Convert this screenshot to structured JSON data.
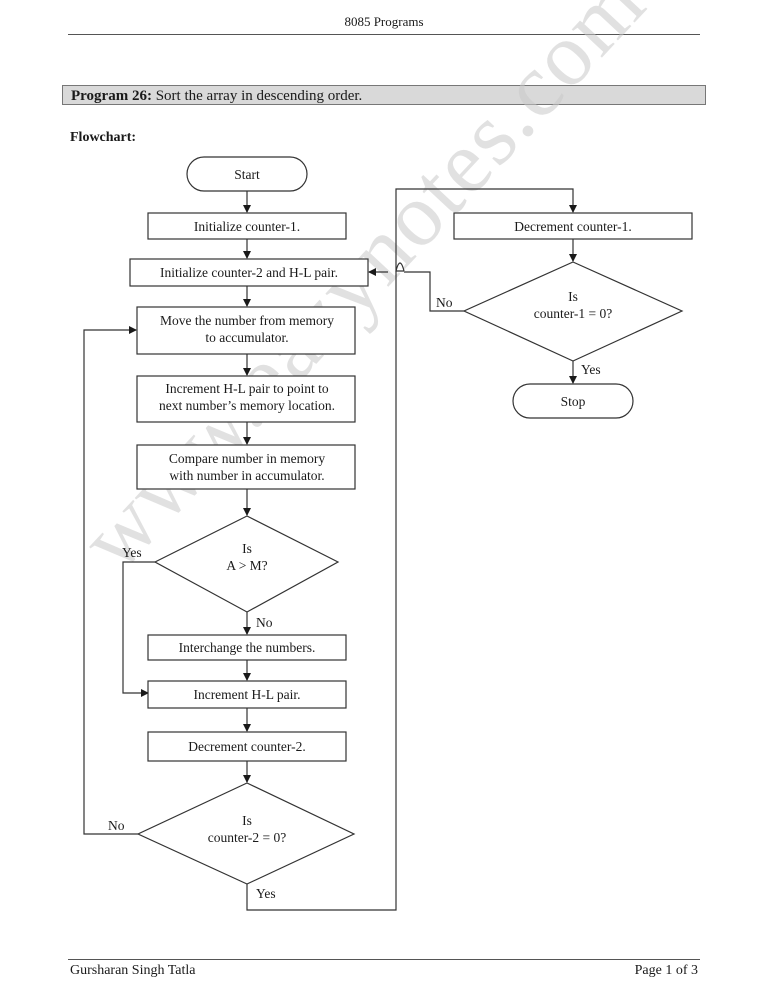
{
  "header": {
    "title": "8085 Programs"
  },
  "program": {
    "label": "Program 26:",
    "description": "Sort the array in descending order."
  },
  "section_label": "Flowchart:",
  "flowchart": {
    "nodes": {
      "start": "Start",
      "init_counter1": "Initialize counter-1.",
      "init_counter2": "Initialize counter-2 and H-L pair.",
      "move_line1": "Move the number from memory",
      "move_line2": "to accumulator.",
      "inc_hl_line1": "Increment H-L pair to point to",
      "inc_hl_line2": "next number’s memory location.",
      "compare_line1": "Compare number in memory",
      "compare_line2": "with number in accumulator.",
      "dec_a_m_line1": "Is",
      "dec_a_m_line2": "A > M?",
      "interchange": "Interchange the numbers.",
      "inc_hl_pair": "Increment H-L pair.",
      "dec_counter2": "Decrement counter-2.",
      "dec_c2_line1": "Is",
      "dec_c2_line2": "counter-2 = 0?",
      "dec_counter1": "Decrement counter-1.",
      "dec_c1_line1": "Is",
      "dec_c1_line2": "counter-1 = 0?",
      "stop": "Stop"
    },
    "labels": {
      "yes": "Yes",
      "no": "No"
    }
  },
  "watermark": "www.eazynotes.com",
  "footer": {
    "author": "Gursharan Singh Tatla",
    "page": "Page 1 of 3"
  }
}
